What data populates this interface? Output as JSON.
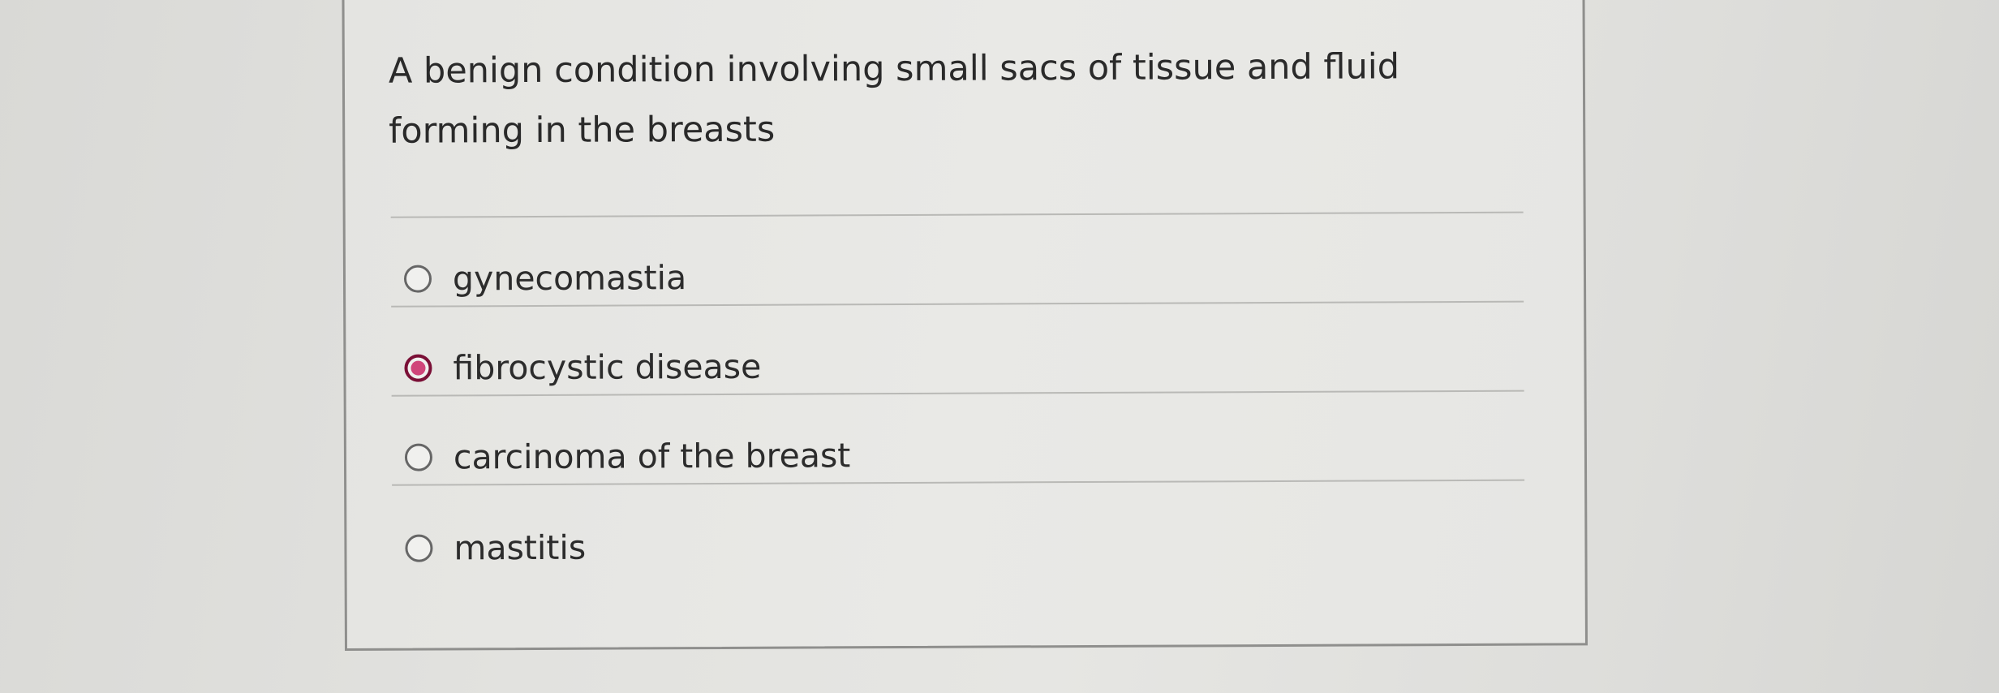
{
  "question": {
    "text": "A benign condition involving small sacs of tissue and fluid forming in the breasts"
  },
  "options": [
    {
      "label": "gynecomastia",
      "selected": false
    },
    {
      "label": "fibrocystic disease",
      "selected": true
    },
    {
      "label": "carcinoma of the breast",
      "selected": false
    },
    {
      "label": "mastitis",
      "selected": false
    }
  ],
  "colors": {
    "selected_outer": "#7a0f36",
    "selected_inner": "#d0457a",
    "card_border": "#8f8f8d"
  }
}
